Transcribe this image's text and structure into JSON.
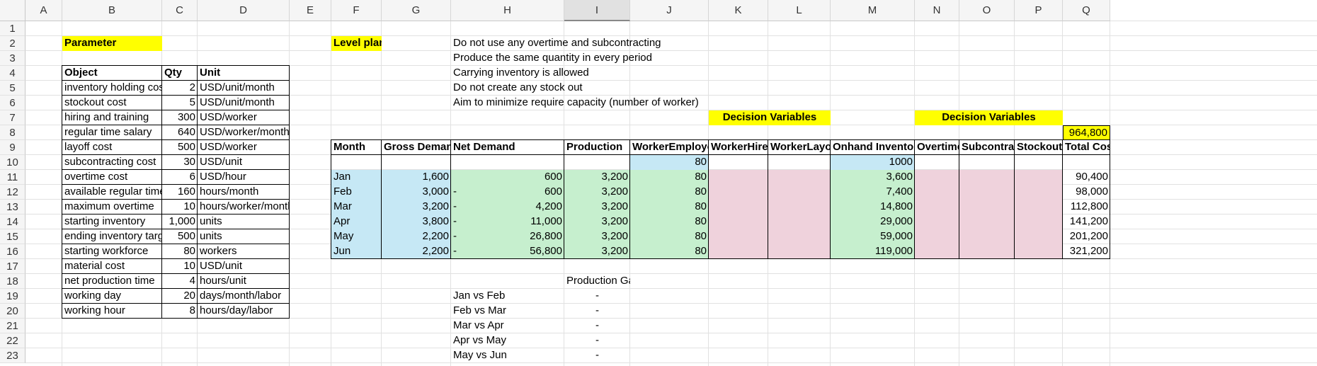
{
  "columns": [
    "A",
    "B",
    "C",
    "D",
    "E",
    "F",
    "G",
    "H",
    "I",
    "J",
    "K",
    "L",
    "M",
    "N",
    "O",
    "P",
    "Q"
  ],
  "rows": [
    "1",
    "2",
    "3",
    "4",
    "5",
    "6",
    "7",
    "8",
    "9",
    "10",
    "11",
    "12",
    "13",
    "14",
    "15",
    "16",
    "17",
    "18",
    "19",
    "20",
    "21",
    "22",
    "23"
  ],
  "parameter": {
    "title": "Parameter",
    "headers": [
      "Object",
      "Qty",
      "Unit"
    ],
    "rows": [
      {
        "object": "inventory holding cost",
        "qty": "2",
        "unit": "USD/unit/month"
      },
      {
        "object": "stockout cost",
        "qty": "5",
        "unit": "USD/unit/month"
      },
      {
        "object": "hiring and training",
        "qty": "300",
        "unit": "USD/worker"
      },
      {
        "object": "regular time salary",
        "qty": "640",
        "unit": "USD/worker/month"
      },
      {
        "object": "layoff cost",
        "qty": "500",
        "unit": "USD/worker"
      },
      {
        "object": "subcontracting cost",
        "qty": "30",
        "unit": "USD/unit"
      },
      {
        "object": "overtime cost",
        "qty": "6",
        "unit": "USD/hour"
      },
      {
        "object": "available regular time",
        "qty": "160",
        "unit": "hours/month"
      },
      {
        "object": "maximum overtime",
        "qty": "10",
        "unit": "hours/worker/month"
      },
      {
        "object": "starting inventory",
        "qty": "1,000",
        "unit": "units"
      },
      {
        "object": "ending inventory target",
        "qty": "500",
        "unit": "units"
      },
      {
        "object": "starting workforce",
        "qty": "80",
        "unit": "workers"
      },
      {
        "object": "material cost",
        "qty": "10",
        "unit": "USD/unit"
      },
      {
        "object": "net production time",
        "qty": "4",
        "unit": "hours/unit"
      },
      {
        "object": "working day",
        "qty": "20",
        "unit": "days/month/labor"
      },
      {
        "object": "working hour",
        "qty": "8",
        "unit": "hours/day/labor"
      }
    ]
  },
  "level_plan": {
    "title": "Level plan",
    "notes": [
      "Do not use any overtime and subcontracting",
      "Produce the same quantity in every period",
      "Carrying inventory is allowed",
      "Do not create any stock out",
      "Aim to minimize require capacity (number of worker)"
    ],
    "decision_label_1": "Decision Variables",
    "decision_label_2": "Decision Variables",
    "total_cost": "964,800",
    "headers": [
      "Month",
      "Gross Demand",
      "Net Demand",
      "Production",
      "WorkerEmployed",
      "WorkerHired",
      "WorkerLayoff",
      "Onhand Inventory",
      "Overtime",
      "Subcontract",
      "Stockout",
      "Total Cost"
    ],
    "initial_workers": "80",
    "initial_inventory": "1000",
    "rows": [
      {
        "month": "Jan",
        "gross": "1,600",
        "net_sign": "",
        "net": "600",
        "production": "3,200",
        "workers": "80",
        "inventory": "3,600",
        "total": "90,400"
      },
      {
        "month": "Feb",
        "gross": "3,000",
        "net_sign": "-",
        "net": "600",
        "production": "3,200",
        "workers": "80",
        "inventory": "7,400",
        "total": "98,000"
      },
      {
        "month": "Mar",
        "gross": "3,200",
        "net_sign": "-",
        "net": "4,200",
        "production": "3,200",
        "workers": "80",
        "inventory": "14,800",
        "total": "112,800"
      },
      {
        "month": "Apr",
        "gross": "3,800",
        "net_sign": "-",
        "net": "11,000",
        "production": "3,200",
        "workers": "80",
        "inventory": "29,000",
        "total": "141,200"
      },
      {
        "month": "May",
        "gross": "2,200",
        "net_sign": "-",
        "net": "26,800",
        "production": "3,200",
        "workers": "80",
        "inventory": "59,000",
        "total": "201,200"
      },
      {
        "month": "Jun",
        "gross": "2,200",
        "net_sign": "-",
        "net": "56,800",
        "production": "3,200",
        "workers": "80",
        "inventory": "119,000",
        "total": "321,200"
      }
    ]
  },
  "production_gap": {
    "title": "Production Gap",
    "rows": [
      {
        "label": "Jan vs Feb",
        "value": "-"
      },
      {
        "label": "Feb vs Mar",
        "value": "-"
      },
      {
        "label": "Mar vs Apr",
        "value": "-"
      },
      {
        "label": "Apr vs May",
        "value": "-"
      },
      {
        "label": "May vs Jun",
        "value": "-"
      }
    ]
  }
}
